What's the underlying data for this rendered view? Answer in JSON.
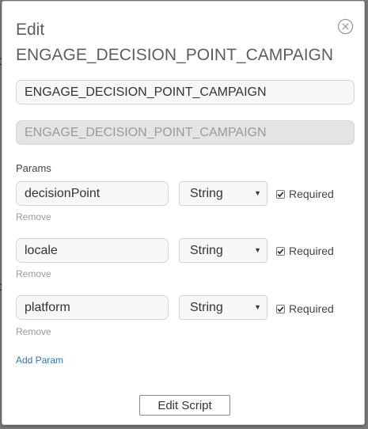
{
  "backdrop": {
    "glyph": "0"
  },
  "dialog": {
    "title": "Edit ENGAGE_DECISION_POINT_CAMPAIGN",
    "name_value": "ENGAGE_DECISION_POINT_CAMPAIGN",
    "id_value": "ENGAGE_DECISION_POINT_CAMPAIGN",
    "params_label": "Params",
    "params": [
      {
        "name": "decisionPoint",
        "type": "String",
        "required_label": "Required",
        "required": true,
        "remove_label": "Remove"
      },
      {
        "name": "locale",
        "type": "String",
        "required_label": "Required",
        "required": true,
        "remove_label": "Remove"
      },
      {
        "name": "platform",
        "type": "String",
        "required_label": "Required",
        "required": true,
        "remove_label": "Remove"
      }
    ],
    "add_param_label": "Add Param",
    "edit_script_label": "Edit Script",
    "close_icon": "circle-x-icon"
  }
}
